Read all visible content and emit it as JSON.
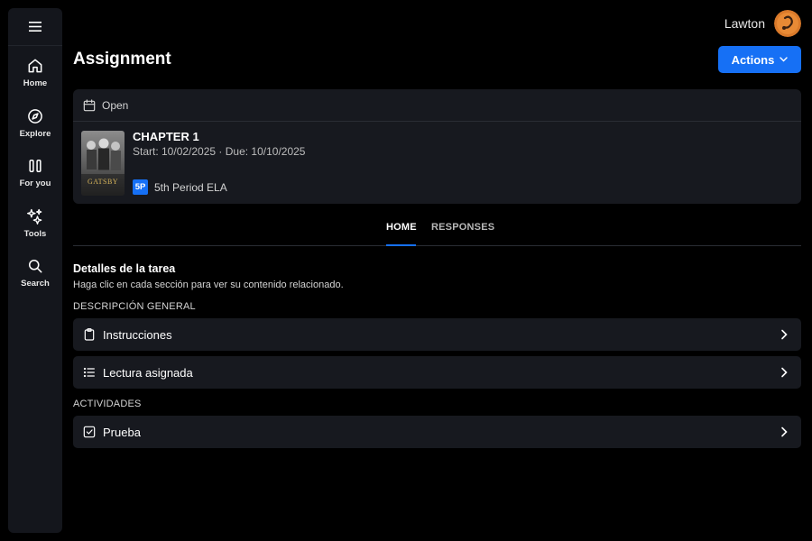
{
  "sidebar": {
    "items": [
      {
        "label": "Home",
        "icon": "home-icon"
      },
      {
        "label": "Explore",
        "icon": "compass-icon"
      },
      {
        "label": "For you",
        "icon": "columns-icon"
      },
      {
        "label": "Tools",
        "icon": "sparkles-icon"
      },
      {
        "label": "Search",
        "icon": "search-icon"
      }
    ]
  },
  "header": {
    "user_name": "Lawton",
    "title": "Assignment",
    "actions_label": "Actions"
  },
  "assignment": {
    "status": "Open",
    "title": "CHAPTER 1",
    "dates": "Start: 10/02/2025 · Due: 10/10/2025",
    "class_badge": "5P",
    "class_name": "5th Period ELA",
    "cover_text": "GATSBY"
  },
  "tabs": [
    {
      "label": "HOME",
      "active": true
    },
    {
      "label": "RESPONSES",
      "active": false
    }
  ],
  "details": {
    "title": "Detalles de la tarea",
    "subtitle": "Haga clic en cada sección para ver su contenido relacionado.",
    "overview_label": "DESCRIPCIÓN GENERAL",
    "overview_items": [
      {
        "label": "Instrucciones",
        "icon": "clipboard-icon"
      },
      {
        "label": "Lectura asignada",
        "icon": "list-icon"
      }
    ],
    "activities_label": "ACTIVIDADES",
    "activity_items": [
      {
        "label": "Prueba",
        "icon": "checkbox-icon"
      }
    ]
  },
  "colors": {
    "accent": "#1670f5",
    "background": "#000000",
    "panel": "#17191f",
    "sidebar": "#14161c"
  }
}
